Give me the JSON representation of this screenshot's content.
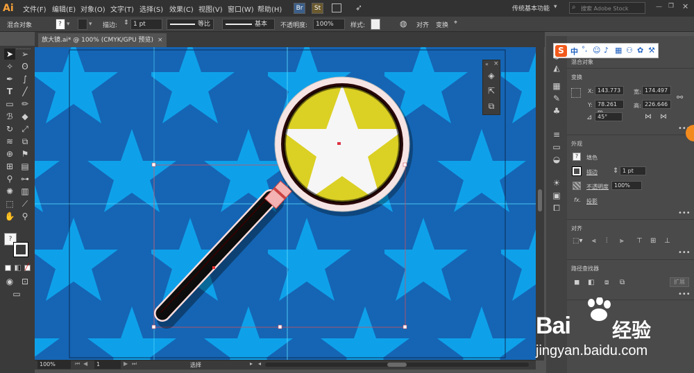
{
  "menubar": {
    "logo": "Ai",
    "items": [
      "文件(F)",
      "编辑(E)",
      "对象(O)",
      "文字(T)",
      "选择(S)",
      "效果(C)",
      "视图(V)",
      "窗口(W)",
      "帮助(H)"
    ],
    "br_label": "Br",
    "st_label": "St",
    "workspace": "传统基本功能",
    "search_placeholder": "搜索 Adobe Stock"
  },
  "options": {
    "object_type": "混合对象",
    "stroke_label": "描边:",
    "stroke_value": "1 pt",
    "profile_label": "等比",
    "brush_label": "基本",
    "opacity_label": "不透明度:",
    "opacity_value": "100%",
    "style_label": "样式:",
    "align_label": "对齐",
    "transform_label": "变换"
  },
  "document": {
    "tab_title": "放大镜.ai* @ 100% (CMYK/GPU 预览)",
    "close": "×"
  },
  "status": {
    "zoom": "100%",
    "page": "1",
    "tool": "选择"
  },
  "panel": {
    "blend_title": "混合对象",
    "transform_title": "变换",
    "x_label": "X:",
    "x_value": "143.773",
    "y_label": "Y:",
    "y_value": "78.261 m",
    "w_label": "宽:",
    "w_value": "174.497",
    "h_label": "高:",
    "h_value": "226.646",
    "angle_value": "45°",
    "appearance_title": "外观",
    "fill_label": "填色",
    "stroke_label": "描边",
    "stroke_value": "1 pt",
    "opacity_label": "不透明度",
    "opacity_value": "100%",
    "fx_label": "fx.",
    "shadow_label": "投影",
    "align_title": "对齐",
    "pathfinder_title": "路径查找器",
    "expand_label": "扩展"
  },
  "ime": {
    "logo": "S",
    "mode": "中"
  },
  "watermark": {
    "brand_left": "Bai",
    "brand_right": "经验",
    "url": "jingyan.baidu.com"
  },
  "colors": {
    "canvas_bg": "#1565b4",
    "star_color": "#0ea1ea",
    "lens_star": "#f6f6f6",
    "lens_bg": "#dbd024",
    "accent": "#f7a13a"
  }
}
